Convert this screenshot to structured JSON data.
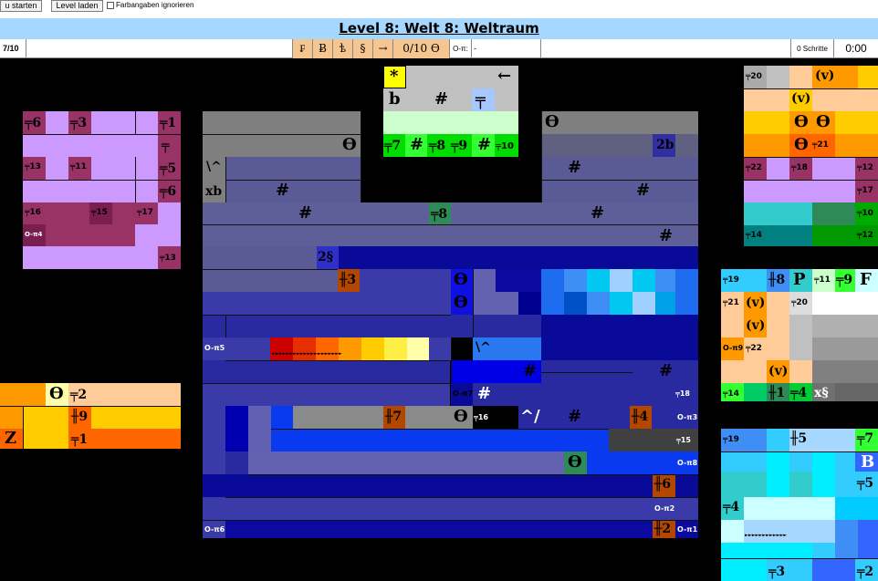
{
  "toolbar": {
    "start": "u starten",
    "load": "Level laden",
    "check": "Farbangaben ignorieren"
  },
  "title": "Level 8: Welt 8: Weltraum",
  "status": {
    "level": "7/10",
    "s1": "₣",
    "s2": "Ƀ",
    "s3": "ѣ",
    "s4": "§",
    "s5": "→",
    "s6": "0/10 ϴ",
    "s7": "O-π:",
    "s8": "-",
    "steps": "0 Schritte",
    "time": "0:00"
  },
  "board": {
    "t1": "*",
    "t2": "←",
    "t3": "b",
    "t4": "#",
    "t5": "╤",
    "t6": "ϴ",
    "t7": "╤7",
    "t8": "#",
    "t9": "╤8",
    "t10": "╤9",
    "t11": "#",
    "t12": "╤10",
    "t13": "ϴ",
    "t14": "2b",
    "t15": "\\^",
    "t16": "#",
    "t17": "xb",
    "t18": "#",
    "t19": "#",
    "t20": "╤8",
    "t21": "#",
    "t22": "#",
    "t23": "2§",
    "t24": "╫3",
    "t25": "ϴ",
    "t26": "ϴ",
    "t27": "O-π5",
    "t28": "\\^",
    "t29": "#",
    "t30": "#",
    "t31": "O-π7",
    "t32": "#",
    "t33": "╤18",
    "t34": "╫7",
    "t35": "ϴ",
    "t36": "╤16",
    "t37": "^/",
    "t38": "#",
    "t39": "╫4",
    "t40": "O-π3",
    "t41": "╤15",
    "t42": "ϴ",
    "t43": "O-π8",
    "t44": "╫6",
    "t45": "O-π2",
    "t46": "O-π6",
    "t47": "╫2",
    "t48": "O-π1",
    "p1": "╤6",
    "p2": "╤3",
    "p3": "╤1",
    "p4": "╤",
    "p5": "╤13",
    "p6": "╤11",
    "p7": "╤5",
    "p8": "╤6",
    "p9": "╤16",
    "p10": "╤15",
    "p11": "╤17",
    "p12": "O-π4",
    "p13": "╤13",
    "o1": "ϴ",
    "o2": "╤2",
    "o3": "╫9",
    "o4": "Z",
    "o5": "╤1",
    "q1": "╤20",
    "q2": "(v)",
    "q3": "(v)",
    "q4": "ϴ",
    "q5": "ϴ",
    "q6": "ϴ",
    "q7": "╤21",
    "q8": "╤22",
    "q9": "╤18",
    "q10": "╤12",
    "q11": "╤17",
    "q12": "╤10",
    "q13": "╤14",
    "q14": "╤12",
    "m1": "╤19",
    "m2": "╫8",
    "m3": "P",
    "m4": "╤11",
    "m5": "╤9",
    "m6": "F",
    "m7": "╤21",
    "m8": "(v)",
    "m9": "╤20",
    "m10": "(v)",
    "m11": "O-π9",
    "m12": "╤22",
    "m13": "(v)",
    "m14": "╤14",
    "m15": "╫1",
    "m16": "╤4",
    "m17": "x§",
    "c1": "╤19",
    "c2": "╫5",
    "c3": "╤7",
    "c4": "B",
    "c5": "╤5",
    "c6": "╤4",
    "c7": "╤3",
    "c8": "╤2"
  },
  "arrows": "►►►►►►►►►►►►►►►►►►►►",
  "arrows2": "►►►►►►►►►►►►"
}
